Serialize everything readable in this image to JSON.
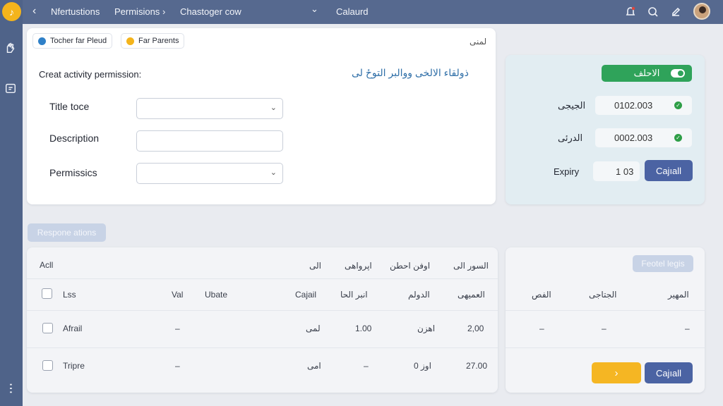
{
  "topbar": {
    "back_glyph": "‹",
    "crumb1": "Nfertustions",
    "crumb2": "Permisions",
    "crumb_sep": "›",
    "crumb3": "Chastoger cow",
    "dropdown_glyph": "⌄",
    "crumb4": "Calaurd",
    "icons": [
      "bell-icon",
      "search-icon",
      "edit-icon",
      "avatar"
    ]
  },
  "rail": {
    "logo_glyph": "♪",
    "icons": [
      "hand-icon",
      "box-icon",
      "menu-dots-icon"
    ]
  },
  "form": {
    "chips": [
      {
        "label": "Tocher far Pleud",
        "color": "#2f80c8"
      },
      {
        "label": "Far Parents",
        "color": "#f4b41c"
      }
    ],
    "corner_label": "لمنی",
    "heading": "Creat activity permission:",
    "heading_rtl": "ذولقاء الالخی ووالبر التوځ لی",
    "fields": [
      {
        "label": "Title toce",
        "type": "select",
        "value": ""
      },
      {
        "label": "Description",
        "type": "text",
        "value": ""
      },
      {
        "label": "Permissics",
        "type": "select",
        "value": ""
      }
    ]
  },
  "right_panel": {
    "green_button": "الاحلف",
    "rows": [
      {
        "label": "الجیجی",
        "value": "0102.003"
      },
      {
        "label": "الدرئی",
        "value": "0002.003"
      }
    ],
    "expiry_label": "Expiry",
    "expiry_value": "1 03",
    "expiry_button": "Cajıall"
  },
  "section_tag": "Respone ations",
  "table": {
    "top_header": [
      "Acll",
      "الی",
      "اپرواهی",
      "اوفن احطن",
      "السور الی"
    ],
    "columns": [
      "Lss",
      "Val",
      "Ubate",
      "Cajail",
      "انبر الحا",
      "الدولم",
      "العمیهی"
    ],
    "rows": [
      {
        "name": "Afrail",
        "val": "–",
        "ubate": "",
        "c3": "لمی",
        "c4": "1.00",
        "c5": "اهزن",
        "c6": "2,00"
      },
      {
        "name": "Tripre",
        "val": "–",
        "ubate": "",
        "c3": "امی",
        "c4": "–",
        "c5": "0 اوز",
        "c6": "27.00"
      }
    ]
  },
  "side_table": {
    "button": "Feotel legis",
    "columns": [
      "الفص",
      "الجتاجی",
      "المهیر"
    ],
    "row": [
      "–",
      "–",
      "–"
    ],
    "yellow_glyph": "›",
    "navy_button": "Cajıall"
  },
  "colors": {
    "navy": "#4b63a3",
    "green": "#2fa35a",
    "yellow": "#f5b623",
    "rail": "#4f6389"
  }
}
